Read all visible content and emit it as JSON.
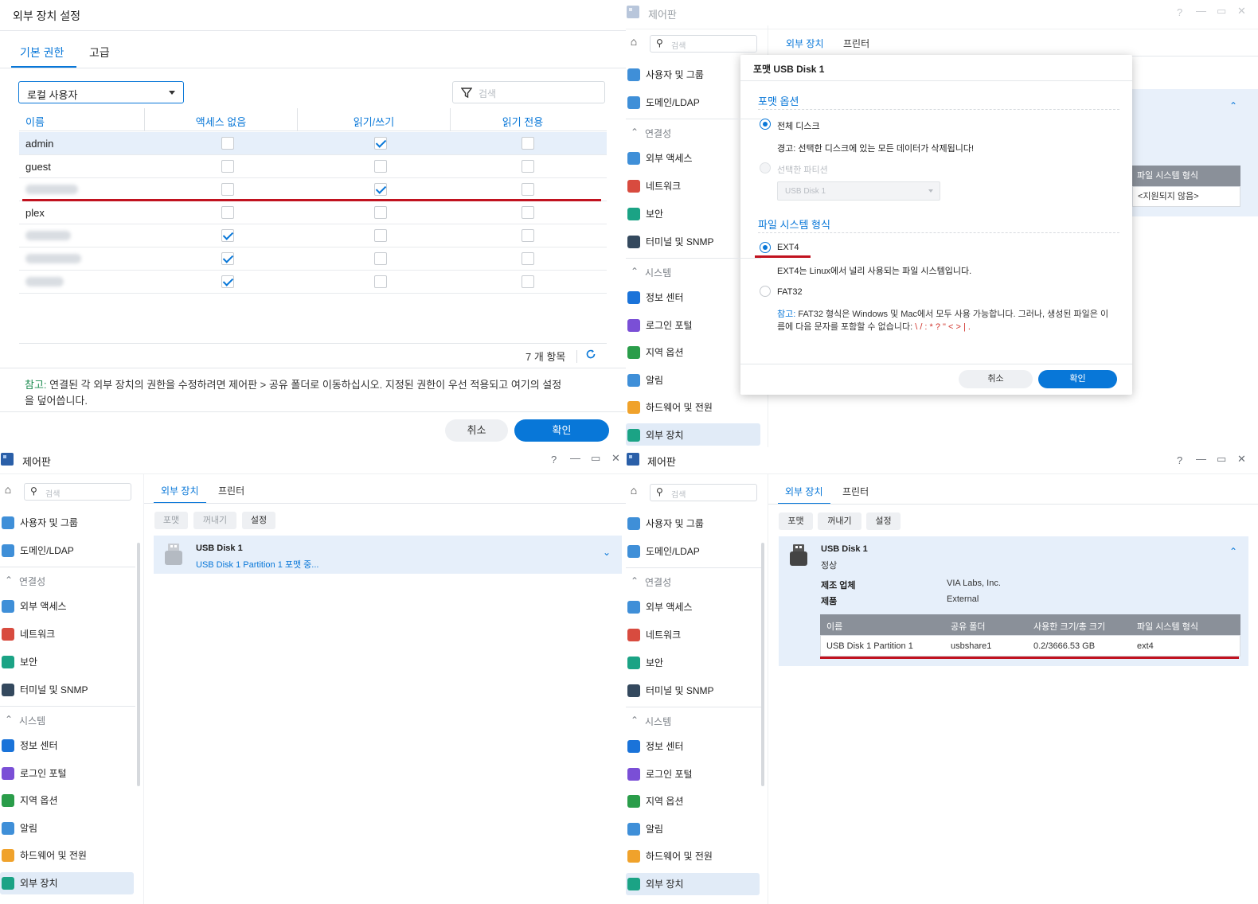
{
  "q1": {
    "title": "외부 장치 설정",
    "tabs": [
      "기본 권한",
      "고급"
    ],
    "user_type": "로컬 사용자",
    "search_placeholder": "검색",
    "columns": [
      "이름",
      "액세스 없음",
      "읽기/쓰기",
      "읽기 전용"
    ],
    "rows": [
      {
        "name": "admin",
        "perm": "rw",
        "selected": true
      },
      {
        "name": "guest",
        "perm": "none"
      },
      {
        "name": "",
        "perm": "rw",
        "blurred": true
      },
      {
        "name": "plex",
        "perm": "none"
      },
      {
        "name": "",
        "perm": "no_access",
        "blurred": true
      },
      {
        "name": "",
        "perm": "no_access",
        "blurred": true
      },
      {
        "name": "",
        "perm": "no_access",
        "blurred": true
      }
    ],
    "count": "7 개 항목",
    "note_label": "참고:",
    "note_text": " 연결된 각 외부 장치의 권한을 수정하려면 제어판 > 공유 폴더로 이동하십시오. 지정된 권한이 우선 적용되고 여기의 설정",
    "note_text2": "을 덮어씁니다.",
    "cancel": "취소",
    "ok": "확인"
  },
  "sidebar": {
    "search_placeholder": "검색",
    "items_top": [
      "사용자 및 그룹",
      "도메인/LDAP"
    ],
    "section_conn": "연결성",
    "items_conn": [
      "외부 액세스",
      "네트워크",
      "보안",
      "터미널 및 SNMP"
    ],
    "section_sys": "시스템",
    "items_sys": [
      "정보 센터",
      "로그인 포털",
      "지역 옵션",
      "알림",
      "하드웨어 및 전원",
      "외부 장치"
    ]
  },
  "window": {
    "title": "제어판",
    "tabs": [
      "외부 장치",
      "프린터"
    ],
    "controls": [
      "?",
      "—",
      "▭",
      "✕"
    ],
    "toolbar": [
      "포맷",
      "꺼내기",
      "설정"
    ]
  },
  "q2": {
    "dialog_title": "포맷 USB Disk 1",
    "format_options": "포맷 옵션",
    "whole_disk": "전체 디스크",
    "warning": "경고: 선택한 디스크에 있는 모든 데이터가 삭제됩니다!",
    "selected_partition": "선택한 파티션",
    "partition_value": "USB Disk 1",
    "fs_section": "파일 시스템 형식",
    "ext4": "EXT4",
    "ext4_desc": "EXT4는 Linux에서 널리 사용되는 파일 시스템입니다.",
    "fat32": "FAT32",
    "note_label": "참고:",
    "note_text": " FAT32 형식은 Windows 및 Mac에서 모두 사용 가능합니다. 그러나, 생성된 파일은 이",
    "note_text2": "름에 다음 문자를 포함할 수 없습니다: ",
    "note_chars": "\\ / : * ? \" < > | .",
    "cancel": "취소",
    "ok": "확인",
    "bg_col": "파일 시스템 형식",
    "bg_val": "<지원되지 않음>"
  },
  "q3": {
    "device_name": "USB Disk 1",
    "device_status": "USB Disk 1 Partition 1 포맷 중..."
  },
  "q4": {
    "device_name": "USB Disk 1",
    "device_status": "정상",
    "manufacturer_label": "제조 업체",
    "manufacturer": "VIA Labs, Inc.",
    "product_label": "제품",
    "product": "External",
    "columns": [
      "이름",
      "공유 폴더",
      "사용한 크기/총 크기",
      "파일 시스템 형식"
    ],
    "row": [
      "USB Disk 1 Partition 1",
      "usbshare1",
      "0.2/3666.53 GB",
      "ext4"
    ]
  },
  "colors": {
    "accent": "#0877d8",
    "highlight": "#c1121f",
    "selected_bg": "#e6effa"
  }
}
